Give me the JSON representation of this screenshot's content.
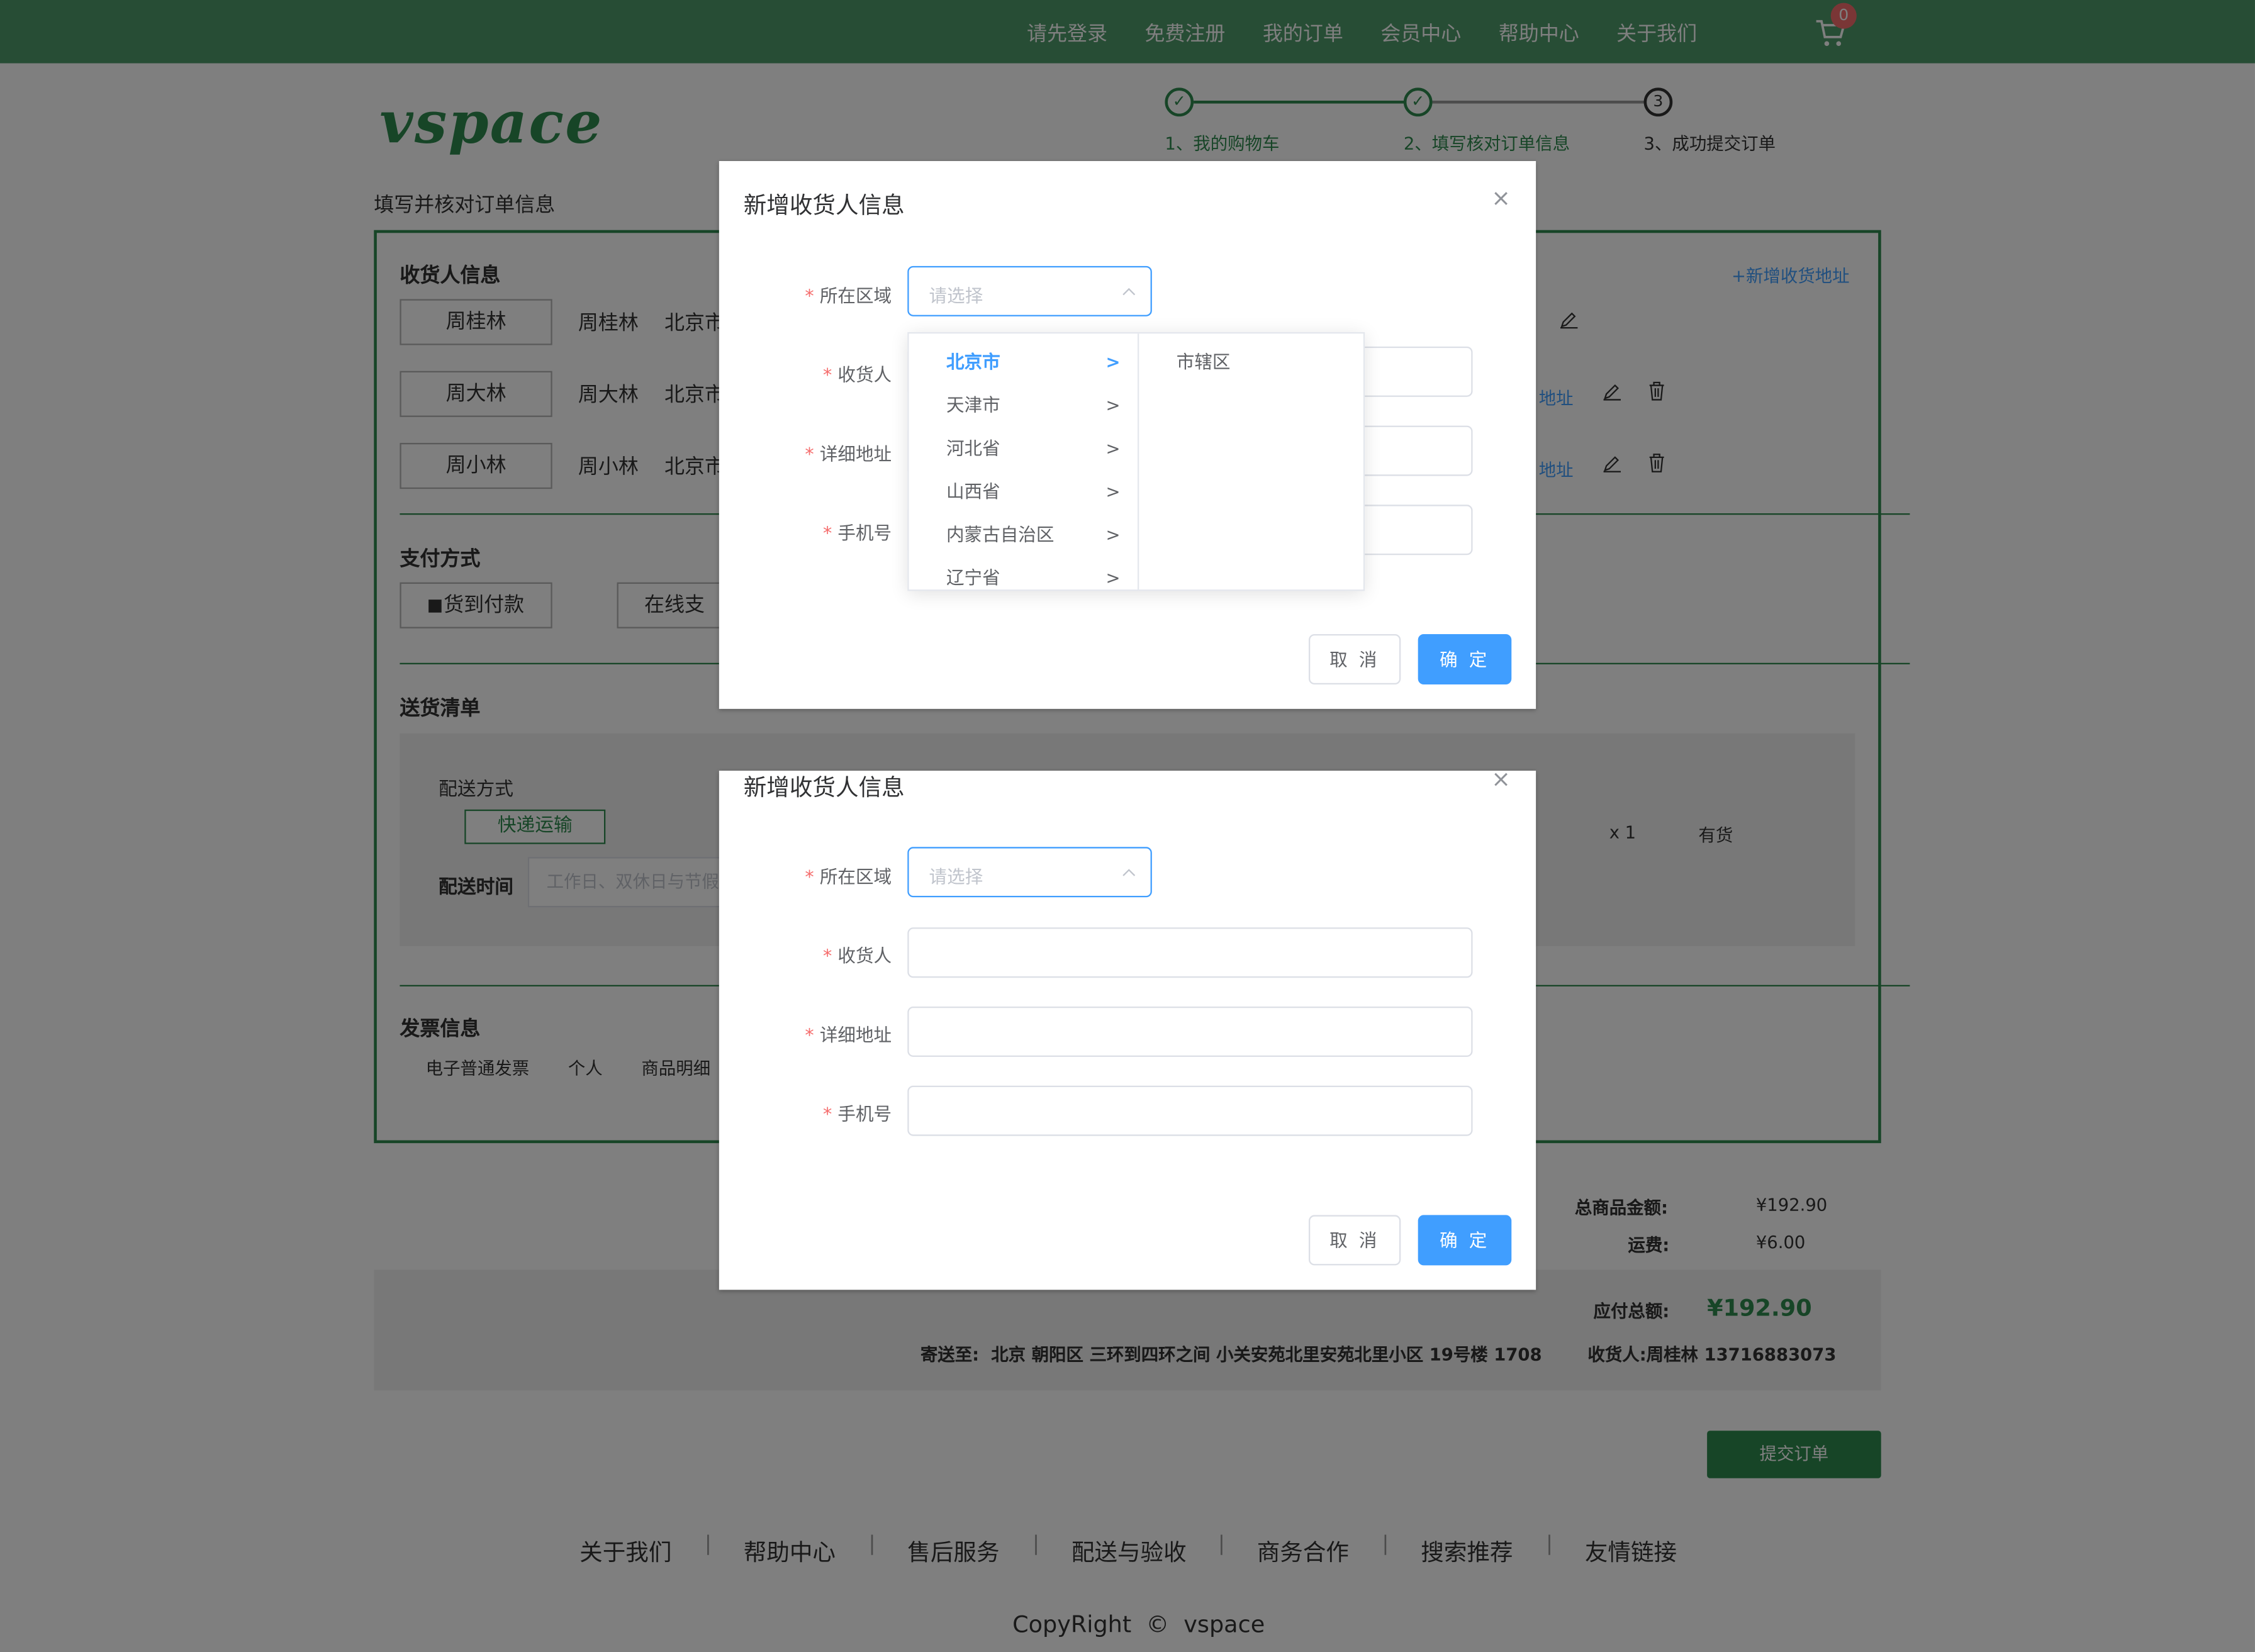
{
  "nav": {
    "items": [
      "请先登录",
      "免费注册",
      "我的订单",
      "会员中心",
      "帮助中心",
      "关于我们"
    ],
    "cart_count": "0"
  },
  "logo": {
    "text": "vspace"
  },
  "steps": [
    {
      "label": "1、我的购物车",
      "marker": "✓",
      "status": "done"
    },
    {
      "label": "2、填写核对订单信息",
      "marker": "✓",
      "status": "done"
    },
    {
      "label": "3、成功提交订单",
      "marker": "3",
      "status": "pending"
    }
  ],
  "page_title": "填写并核对订单信息",
  "receiver": {
    "title": "收货人信息",
    "add_link": "+新增收货地址",
    "set_default": "地址",
    "entries": [
      {
        "tag": "周桂林",
        "name": "周桂林",
        "city": "北京市"
      },
      {
        "tag": "周大林",
        "name": "周大林",
        "city": "北京市"
      },
      {
        "tag": "周小林",
        "name": "周小林",
        "city": "北京市"
      }
    ]
  },
  "payment": {
    "title": "支付方式",
    "cod": "货到付款",
    "online": "在线支"
  },
  "delivery": {
    "title": "送货清单",
    "method_label": "配送方式",
    "method_value": "快递运输",
    "time_label": "配送时间",
    "time_placeholder": "工作日、双休日与节假",
    "qty": "x 1",
    "stock": "有货"
  },
  "invoice": {
    "title": "发票信息",
    "type": "电子普通发票",
    "person": "个人",
    "detail": "商品明细"
  },
  "summary": {
    "goods_label": "总商品金额:",
    "goods_value": "¥192.90",
    "freight_label": "运费:",
    "freight_value": "¥6.00",
    "payable_label": "应付总额:",
    "payable_value": "¥192.90",
    "ship_to": "寄送至:  北京 朝阳区 三环到四环之间 小关安苑北里安苑北里小区 19号楼 1708",
    "receiver": "收货人:周桂林 13716883073",
    "submit": "提交订单"
  },
  "footer": {
    "links": [
      "关于我们",
      "帮助中心",
      "售后服务",
      "配送与验收",
      "商务合作",
      "搜索推荐",
      "友情链接"
    ],
    "copyright": "CopyRight  ©  vspace"
  },
  "dialog": {
    "title": "新增收货人信息",
    "region_label": "所在区域",
    "region_placeholder": "请选择",
    "receiver_label": "收货人",
    "address_label": "详细地址",
    "phone_label": "手机号",
    "cancel": "取 消",
    "confirm": "确 定"
  },
  "cascader": {
    "provinces": [
      "北京市",
      "天津市",
      "河北省",
      "山西省",
      "内蒙古自治区",
      "辽宁省"
    ],
    "selected": "北京市",
    "districts": [
      "市辖区"
    ]
  },
  "colors": {
    "brand_green": "#2e8a4e",
    "primary": "#409eff",
    "required": "#f56c6c"
  }
}
